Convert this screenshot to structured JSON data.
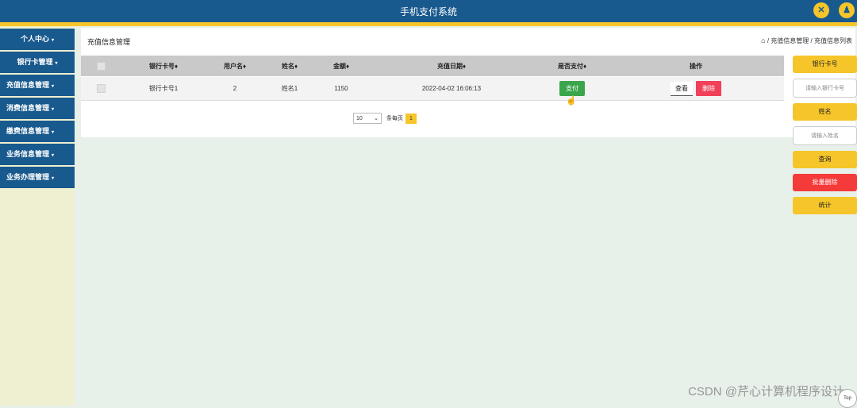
{
  "app": {
    "title": "手机支付系统"
  },
  "header_icons": [
    "close-x-icon",
    "user-icon"
  ],
  "sidebar": {
    "items": [
      {
        "label": "个人中心"
      },
      {
        "label": "银行卡管理"
      },
      {
        "label": "充值信息管理"
      },
      {
        "label": "消费信息管理"
      },
      {
        "label": "缴费信息管理"
      },
      {
        "label": "业务信息管理"
      },
      {
        "label": "业务办理管理"
      }
    ]
  },
  "page": {
    "heading": "充值信息管理",
    "breadcrumb": {
      "part1": "充值信息管理",
      "sep": "/",
      "part2": "充值信息列表"
    }
  },
  "table": {
    "headers": [
      "银行卡号",
      "用户名",
      "姓名",
      "金额",
      "充值日期",
      "是否支付",
      "操作"
    ],
    "rows": [
      {
        "card": "银行卡号1",
        "user": "2",
        "name": "姓名1",
        "amount": "1150",
        "date": "2022-04-02 16:06:13"
      }
    ],
    "pay_label": "支付",
    "view_label": "查看",
    "delete_label": "删除"
  },
  "pager": {
    "page_size": "10",
    "per_page_label": "条每页",
    "current": "1"
  },
  "right_panel": {
    "card_label": "银行卡号",
    "card_placeholder": "请输入银行卡号",
    "name_label": "姓名",
    "name_placeholder": "请输入姓名",
    "query_label": "查询",
    "batch_delete_label": "批量删除",
    "stats_label": "统计"
  },
  "watermark": "CSDN @芹心计算机程序设计",
  "back_to_top": "Top",
  "colors": {
    "primary": "#18598e",
    "accent": "#f5c52a",
    "danger": "#f0405a",
    "success": "#3aa64b"
  }
}
